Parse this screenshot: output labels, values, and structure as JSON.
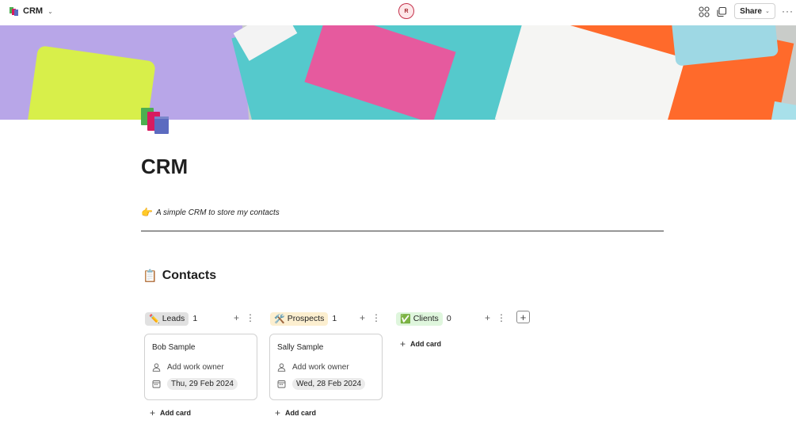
{
  "header": {
    "title": "CRM",
    "avatar_initial": "R",
    "share_label": "Share",
    "more_label": "···"
  },
  "page": {
    "title": "CRM",
    "subtitle_emoji": "👉",
    "subtitle": "A simple CRM to store my contacts"
  },
  "section": {
    "emoji": "📋",
    "title": "Contacts"
  },
  "board": {
    "columns": [
      {
        "emoji": "✏️",
        "label": "Leads",
        "count": "1",
        "color": "#e1e1e1",
        "add_card_label": "Add card",
        "cards": [
          {
            "title": "Bob Sample",
            "owner_placeholder": "Add work owner",
            "date": "Thu, 29 Feb 2024"
          }
        ]
      },
      {
        "emoji": "🛠️",
        "label": "Prospects",
        "count": "1",
        "color": "#fcefd0",
        "add_card_label": "Add card",
        "cards": [
          {
            "title": "Sally Sample",
            "owner_placeholder": "Add work owner",
            "date": "Wed, 28 Feb 2024"
          }
        ]
      },
      {
        "emoji": "✅",
        "label": "Clients",
        "count": "0",
        "color": "#dff6dd",
        "add_card_label": "Add card",
        "cards": []
      }
    ],
    "add_column_label": "+"
  }
}
